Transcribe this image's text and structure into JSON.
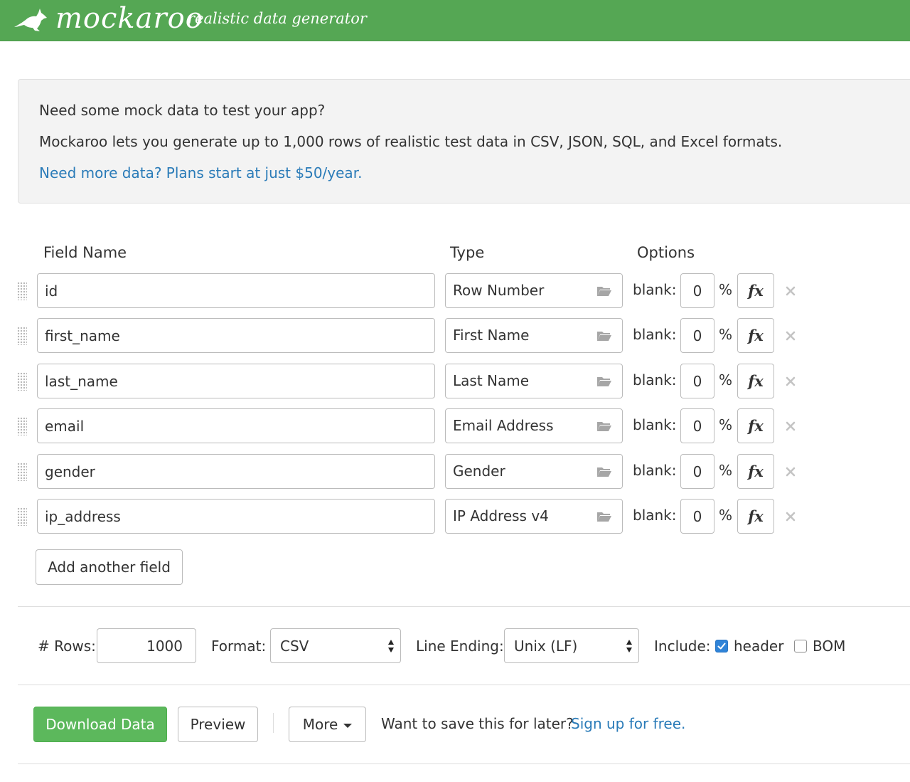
{
  "header": {
    "logo_text": "mockaroo",
    "tagline": "realistic data generator",
    "brand_color": "#55a754"
  },
  "intro": {
    "line1": "Need some mock data to test your app?",
    "line2": "Mockaroo lets you generate up to 1,000 rows of realistic test data in CSV, JSON, SQL, and Excel formats.",
    "link": "Need more data? Plans start at just $50/year."
  },
  "columns": {
    "field_name": "Field Name",
    "type": "Type",
    "options": "Options"
  },
  "fields": [
    {
      "name": "id",
      "type": "Row Number",
      "blank_label": "blank:",
      "blank": "0",
      "pct": "%",
      "fx": "fx"
    },
    {
      "name": "first_name",
      "type": "First Name",
      "blank_label": "blank:",
      "blank": "0",
      "pct": "%",
      "fx": "fx"
    },
    {
      "name": "last_name",
      "type": "Last Name",
      "blank_label": "blank:",
      "blank": "0",
      "pct": "%",
      "fx": "fx"
    },
    {
      "name": "email",
      "type": "Email Address",
      "blank_label": "blank:",
      "blank": "0",
      "pct": "%",
      "fx": "fx"
    },
    {
      "name": "gender",
      "type": "Gender",
      "blank_label": "blank:",
      "blank": "0",
      "pct": "%",
      "fx": "fx"
    },
    {
      "name": "ip_address",
      "type": "IP Address v4",
      "blank_label": "blank:",
      "blank": "0",
      "pct": "%",
      "fx": "fx"
    }
  ],
  "add_field_label": "Add another field",
  "settings": {
    "rows_label": "# Rows:",
    "rows_value": "1000",
    "format_label": "Format:",
    "format_value": "CSV",
    "line_ending_label": "Line Ending:",
    "line_ending_value": "Unix (LF)",
    "include_label": "Include:",
    "header_label": "header",
    "header_checked": true,
    "bom_label": "BOM",
    "bom_checked": false
  },
  "actions": {
    "download_label": "Download Data",
    "preview_label": "Preview",
    "more_label": "More",
    "save_text": "Want to save this for later?",
    "signup_link": "Sign up for free."
  }
}
